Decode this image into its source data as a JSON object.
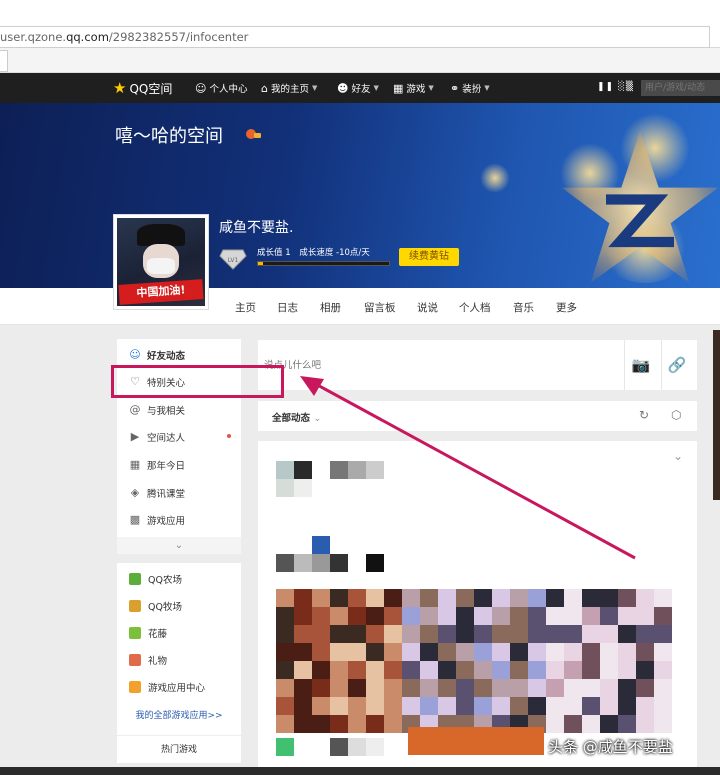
{
  "browser": {
    "url_prefix": "user.qzone.",
    "url_host": "qq.com",
    "url_path": "/2982382557/infocenter"
  },
  "topnav": {
    "logo": "QQ空间",
    "items": [
      {
        "icon": "person-icon",
        "label": "个人中心",
        "caret": false
      },
      {
        "icon": "home-icon",
        "label": "我的主页",
        "caret": true
      },
      {
        "icon": "friends-icon",
        "label": "好友",
        "caret": true
      },
      {
        "icon": "grid-icon",
        "label": "游戏",
        "caret": true
      },
      {
        "icon": "shirt-icon",
        "label": "装扮",
        "caret": true
      }
    ],
    "search_placeholder": "用户/游戏/动态"
  },
  "profile": {
    "space_title": "嘻～哈的空间",
    "username": "咸鱼不要盐.",
    "level_badge": "LV1",
    "growth_value": "成长值 1",
    "growth_speed": "成长速度 -10点/天",
    "growth_progress": 0.04,
    "renew_button": "续费黄钻",
    "avatar_tag": "中国加油!"
  },
  "tabs": [
    "主页",
    "日志",
    "相册",
    "留言板",
    "说说",
    "个人档",
    "音乐",
    "更多"
  ],
  "sidebar": {
    "items": [
      {
        "icon": "friends-feed-icon",
        "label": "好友动态",
        "active": true
      },
      {
        "icon": "heart-icon",
        "label": "特别关心",
        "active": false
      },
      {
        "icon": "at-icon",
        "label": "与我相关",
        "active": false
      },
      {
        "icon": "play-icon",
        "label": "空间达人",
        "active": false,
        "dot": true
      },
      {
        "icon": "calendar-icon",
        "label": "那年今日",
        "active": false
      },
      {
        "icon": "class-icon",
        "label": "腾讯课堂",
        "active": false
      },
      {
        "icon": "apps-icon",
        "label": "游戏应用",
        "active": false
      }
    ],
    "games": [
      {
        "label": "QQ农场",
        "color": "#5cae3a"
      },
      {
        "label": "QQ牧场",
        "color": "#d9a030"
      },
      {
        "label": "花藤",
        "color": "#7bbf3a"
      },
      {
        "label": "礼物",
        "color": "#e06a4a"
      },
      {
        "label": "游戏应用中心",
        "color": "#f2a22a"
      }
    ],
    "all_games_link": "我的全部游戏应用>>",
    "hot_games": "热门游戏"
  },
  "post": {
    "placeholder": "说点儿什么吧"
  },
  "feed": {
    "filter_label": "全部动态"
  },
  "watermark": "头条 @咸鱼不要盐",
  "colors": {
    "highlight": "#c8175d",
    "renew": "#ffd800",
    "topnav": "#1f1f1f"
  }
}
